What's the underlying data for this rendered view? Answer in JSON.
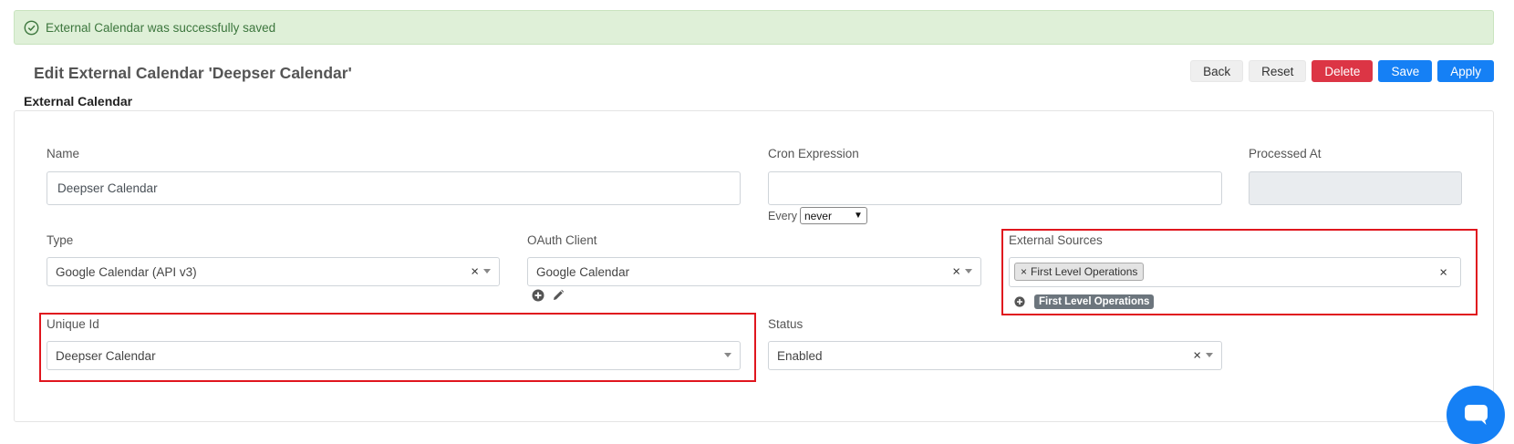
{
  "alert": {
    "message": "External Calendar was successfully saved",
    "icon": "check-circle-icon"
  },
  "header": {
    "title": "Edit External Calendar 'Deepser Calendar'",
    "section": "External Calendar"
  },
  "toolbar": {
    "back": "Back",
    "reset": "Reset",
    "delete": "Delete",
    "save": "Save",
    "apply": "Apply"
  },
  "form": {
    "name": {
      "label": "Name",
      "value": "Deepser Calendar"
    },
    "cron": {
      "label": "Cron Expression",
      "value": "",
      "every_label": "Every",
      "every_value": "never"
    },
    "processed_at": {
      "label": "Processed At",
      "value": ""
    },
    "type": {
      "label": "Type",
      "value": "Google Calendar (API v3)"
    },
    "oauth_client": {
      "label": "OAuth Client",
      "value": "Google Calendar"
    },
    "external_sources": {
      "label": "External Sources",
      "tag": "First Level Operations",
      "badge": "First Level Operations"
    },
    "unique_id": {
      "label": "Unique Id",
      "value": "Deepser Calendar"
    },
    "status": {
      "label": "Status",
      "value": "Enabled"
    }
  },
  "colors": {
    "success_bg": "#dff0d8",
    "danger": "#dc3545",
    "primary": "#1580f5",
    "highlight": "#e0161e"
  }
}
